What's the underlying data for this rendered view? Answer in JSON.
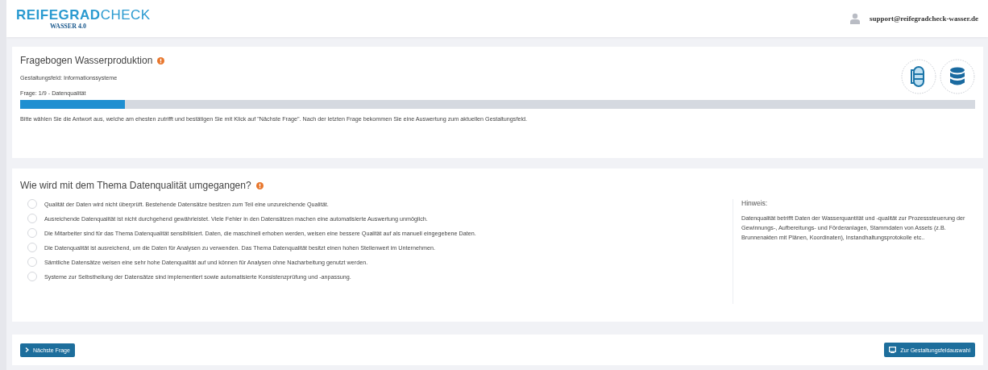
{
  "header": {
    "logo": "**REIFEGRAD**CHECK",
    "logo_subtitle": "WASSER 4.0",
    "user_email": "support@reifegradcheck-wasser.de"
  },
  "questionnaire": {
    "title": "Fragebogen Wasserproduktion",
    "field": "Gestaltungsfeld: Informationssysteme",
    "question_number": "Frage: 1/9 - Datenqualität",
    "progress": {
      "level": 0.11
    },
    "instructions": "Bitte wählen Sie die Antwort aus, welche am ehesten zutrifft und bestätigen Sie mit Klick auf \"Nächste Frage\". Nach der letzten Frage bekommen Sie eine Auswertung zum aktuellen Gestaltungsfeld."
  },
  "question": {
    "title": "Wie wird mit dem Thema Datenqualität umgegangen?",
    "options": [
      {
        "label": "Qualität der Daten wird nicht überprüft. Bestehende Datensätze besitzen zum Teil eine unzureichende Qualität.",
        "selected": false
      },
      {
        "label": "Ausreichende Datenqualität ist nicht durchgehend gewährleistet. Viele Fehler in den Datensätzen machen eine automatisierte Auswertung unmöglich.",
        "selected": false
      },
      {
        "label": "Die Mitarbeiter sind für das Thema Datenqualität sensibilisiert. Daten, die maschinell erhoben werden, weisen eine bessere Qualität auf als manuell eingegebene Daten.",
        "selected": false
      },
      {
        "label": "Die Datenqualität ist ausreichend, um die Daten für Analysen zu verwenden. Das Thema Datenqualität besitzt einen hohen Stellenwert im Unternehmen.",
        "selected": false
      },
      {
        "label": "Sämtliche Datensätze weisen eine sehr hohe Datenqualität auf und können für Analysen ohne Nacharbeitung genutzt werden.",
        "selected": false
      },
      {
        "label": "Systeme zur Selbstheilung der Datensätze sind implementiert sowie automatisierte Konsistenzprüfung und -anpassung.",
        "selected": false
      }
    ],
    "hint_title": "Hinweis:",
    "hint_text": "Datenqualität betrifft Daten der Wasserquantität und -qualität zur Prozesssteuerung der Gewinnungs-, Aufbereitungs- und Förderanlagen, Stammdaten von Assets (z.B. Brunnenakten mit Plänen, Koordinaten), Instandhaltungsprotokolle etc.."
  },
  "footer": {
    "next_button": "Nächste Frage",
    "overview_button": "Zur Gestaltungsfeldauswahl"
  }
}
